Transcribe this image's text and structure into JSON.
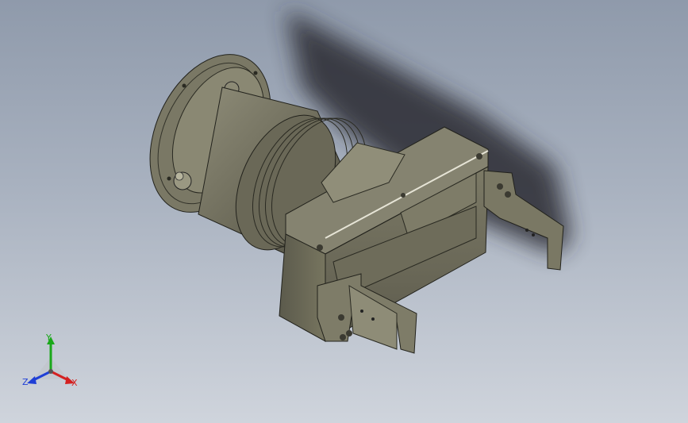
{
  "viewport": {
    "background_top": "#8f9aab",
    "background_bottom": "#cfd4dc"
  },
  "model": {
    "body_color": "#6e6c5b",
    "highlight_color": "#8b8973",
    "shadow_color": "#2f2f35"
  },
  "triad": {
    "x_label": "X",
    "y_label": "Y",
    "z_label": "Z",
    "x_color": "#d42020",
    "y_color": "#1aa81a",
    "z_color": "#1f3fd6"
  }
}
